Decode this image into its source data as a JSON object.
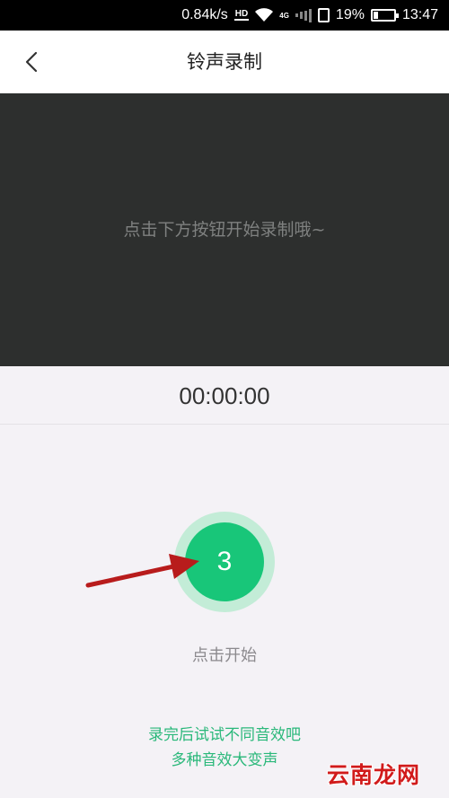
{
  "status_bar": {
    "network_speed": "0.84k/s",
    "hd_label": "HD",
    "lte_label": "4G",
    "battery_percent": "19%",
    "battery_level": 0.19,
    "time": "13:47"
  },
  "header": {
    "title": "铃声录制",
    "back_icon": "chevron-left-icon"
  },
  "preview": {
    "hint": "点击下方按钮开始录制哦~"
  },
  "timer": {
    "value": "00:00:00"
  },
  "record_button": {
    "countdown": "3",
    "color": "#18c679",
    "ring_color": "#c3ecd7"
  },
  "start_label": "点击开始",
  "tips": [
    "录完后试试不同音效吧",
    "多种音效大变声"
  ],
  "watermark": "云南龙网",
  "colors": {
    "accent": "#18c679",
    "tip_text": "#2ab87a",
    "annotation_arrow": "#b81c1c"
  }
}
